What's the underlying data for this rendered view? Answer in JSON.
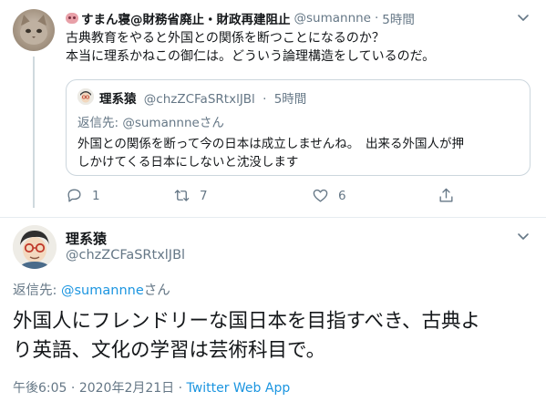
{
  "parent": {
    "name": "すまん寝@財務省廃止・財政再建阻止",
    "handle": "@sumannne",
    "separator": "·",
    "time": "5時間",
    "text_line1": "古典教育をやると外国との関係を断つことになるのか？",
    "text_line2": "本当に理系かねこの御仁は。どういう論理構造をしているのだ。",
    "avatar_icon": "cat-avatar",
    "name_emoji": "pig-nose-emoji"
  },
  "quote": {
    "name": "理系猿",
    "handle": "@chzZCFaSRtxlJBl",
    "separator": "·",
    "time": "5時間",
    "reply_to": "返信先: @sumannneさん",
    "text_line1": "外国との関係を断って今の日本は成立しませんね。　出来る外国人が押",
    "text_line2": "しかけてくる日本にしないと沈没します"
  },
  "actions": {
    "reply_count": "1",
    "retweet_count": "7",
    "like_count": "6",
    "icons": [
      "reply-icon",
      "retweet-icon",
      "like-icon",
      "share-icon"
    ]
  },
  "main": {
    "name": "理系猿",
    "handle": "@chzZCFaSRtxlJBl",
    "reply_prefix": "返信先: ",
    "reply_mention": "@sumannne",
    "reply_suffix": "さん",
    "text_line1": "外国人にフレンドリーな国日本を目指すべき、古典よ",
    "text_line2": "り英語、文化の学習は芸術科目で。",
    "time": "午後6:05",
    "meta_separator": "·",
    "date": "2020年2月21日",
    "app": "Twitter Web App"
  },
  "colors": {
    "link": "#1b95e0",
    "secondary": "#657786",
    "border": "#ccd6dd"
  }
}
